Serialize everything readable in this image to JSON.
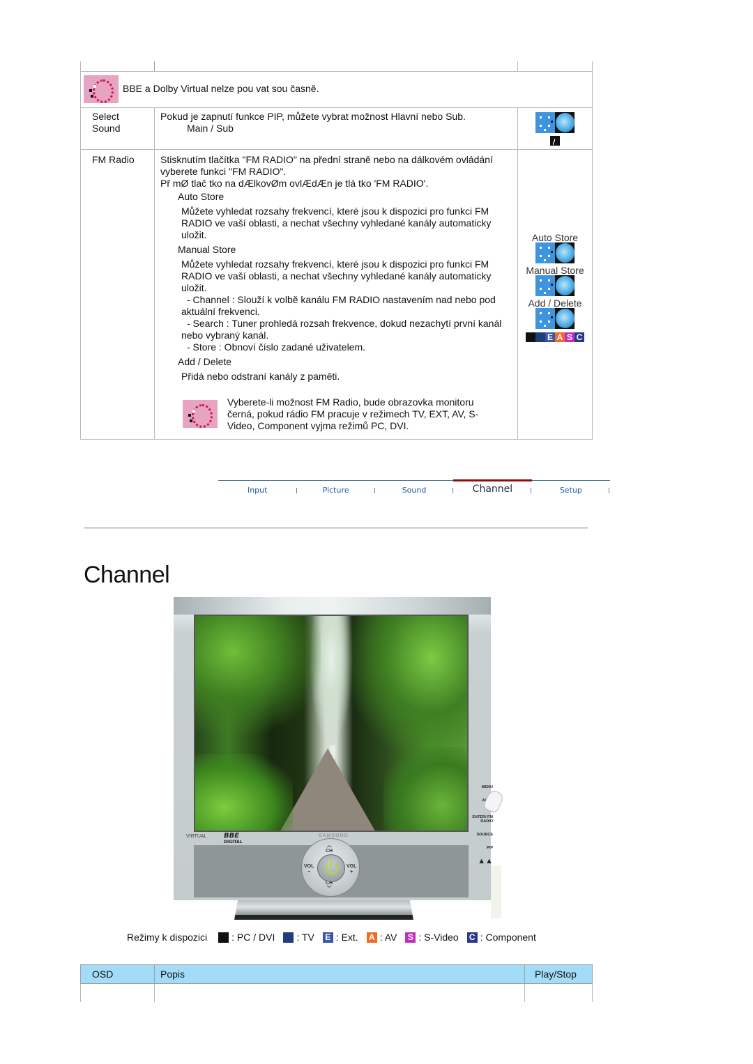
{
  "top_table": {
    "note_bbe": "BBE a Dolby Virtual nelze pou  vat sou     časně.",
    "rows": [
      {
        "osd": "Select Sound",
        "description": "Pokud je zapnutí funkce PIP, můžete vybrat možnost Hlavní nebo Sub.",
        "sub": "Main / Sub"
      }
    ],
    "fm_radio": {
      "osd": "FM Radio",
      "intro_1": "Stisknutím tlačítka \"FM RADIO\" na přední straně nebo na dálkovém ovládání vyberete funkci \"FM RADIO\".",
      "intro_2": "Př mØ tlač tko na dÆlkovØm ovlÆdÆn  je tlá tko 'FM RADIO'.",
      "auto_store": {
        "title": "Auto Store",
        "text": "Můžete vyhledat rozsahy frekvencí, které jsou k dispozici pro funkci FM RADIO ve vaší oblasti, a nechat všechny vyhledané kanály automaticky uložit."
      },
      "manual_store": {
        "title": "Manual Store",
        "text": "Můžete vyhledat rozsahy frekvencí, které jsou k dispozici pro funkci FM RADIO ve vaší oblasti, a nechat všechny vyhledané kanály automaticky uložit.",
        "channel": "- Channel  : Slouží k volbě kanálu FM RADIO nastavením nad nebo pod aktuální frekvenci.",
        "search": "- Search  : Tuner prohledá rozsah frekvence, dokud nezachytí první kanál nebo vybraný kanál.",
        "store": "- Store  : Obnoví číslo zadané uživatelem."
      },
      "add_delete": {
        "title": "Add / Delete",
        "text": "Přidá nebo odstraní kanály z paměti."
      },
      "warning": "Vyberete-li možnost FM Radio, bude obrazovka monitoru černá, pokud rádio FM pracuje v režimech TV, EXT, AV, S-Video, Component vyjma režimů PC, DVI.",
      "side_labels": [
        "Auto Store",
        "Manual Store",
        "Add / Delete"
      ],
      "mode_strip": [
        "PC",
        "TV",
        "E",
        "A",
        "S",
        "C"
      ]
    }
  },
  "nav": {
    "tabs": [
      {
        "label": "Input",
        "active": false
      },
      {
        "label": "Picture",
        "active": false
      },
      {
        "label": "Sound",
        "active": false
      },
      {
        "label": "Channel",
        "active": true
      },
      {
        "label": "Setup",
        "active": false
      }
    ],
    "active_color": "#8b0d0d",
    "tab_color": "#2060a0"
  },
  "page_title": "Channel",
  "monitor": {
    "brand": "SAMSUNG",
    "logo_virtual": "VIRTUAL",
    "logo_bbe": "BBE",
    "logo_digital": "DIGITAL",
    "dpad": {
      "up": "CH",
      "down": "CH",
      "left": "VOL",
      "right": "VOL",
      "left_sign": "−",
      "right_sign": "+"
    },
    "side_buttons": [
      "MENU",
      "AUTO",
      "ENTER/ FM RADIO",
      "SOURCE",
      "PIP"
    ]
  },
  "legend": {
    "label": "Režimy k dispozici",
    "items": [
      {
        "icon": "",
        "text": ": PC / DVI",
        "color": "#111111"
      },
      {
        "icon": "",
        "text": ": TV",
        "color": "#1f3f7a"
      },
      {
        "icon": "E",
        "text": ": Ext.",
        "color": "#3a56a8"
      },
      {
        "icon": "A",
        "text": ": AV",
        "color": "#f06a2a"
      },
      {
        "icon": "S",
        "text": ": S-Video",
        "color": "#c030c0"
      },
      {
        "icon": "C",
        "text": ": Component",
        "color": "#2a3a8a"
      }
    ]
  },
  "bottom_table": {
    "headers": [
      "OSD",
      "Popis",
      "Play/Stop"
    ],
    "header_bg": "#a3dcf8"
  }
}
